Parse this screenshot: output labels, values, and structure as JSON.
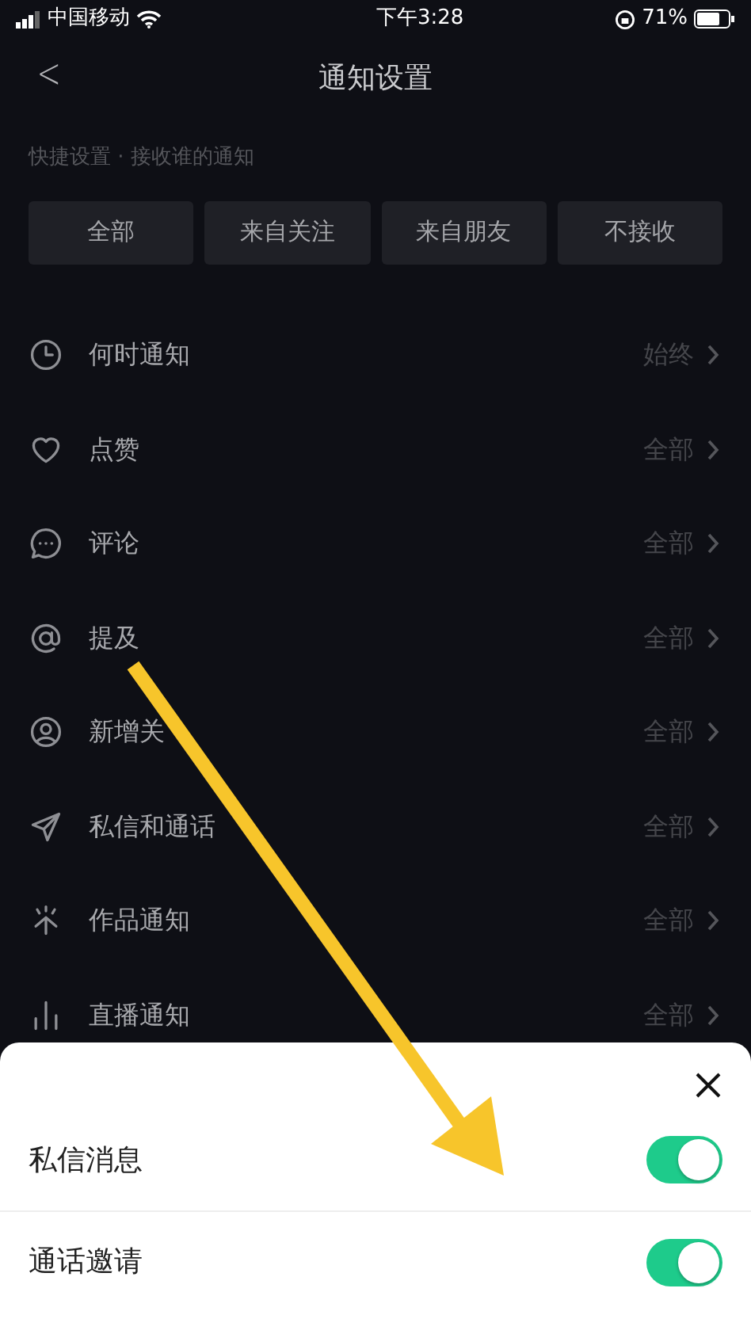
{
  "status_bar": {
    "carrier": "中国移动",
    "time": "下午3:28",
    "battery": "71%"
  },
  "header": {
    "back": "<",
    "title": "通知设置"
  },
  "quick": {
    "label": "快捷设置 · 接收谁的通知",
    "options": [
      {
        "label": "全部"
      },
      {
        "label": "来自关注"
      },
      {
        "label": "来自朋友"
      },
      {
        "label": "不接收"
      }
    ]
  },
  "settings": [
    {
      "label": "何时通知",
      "value": "始终"
    },
    {
      "label": "点赞",
      "value": "全部"
    },
    {
      "label": "评论",
      "value": "全部"
    },
    {
      "label": "提及",
      "value": "全部"
    },
    {
      "label": "新增关",
      "value": "全部"
    },
    {
      "label": "私信和通话",
      "value": "全部"
    },
    {
      "label": "作品通知",
      "value": "全部"
    },
    {
      "label": "直播通知",
      "value": "全部"
    }
  ],
  "sheet": {
    "toggles": [
      {
        "label": "私信消息",
        "on": true
      },
      {
        "label": "通话邀请",
        "on": true
      }
    ]
  }
}
